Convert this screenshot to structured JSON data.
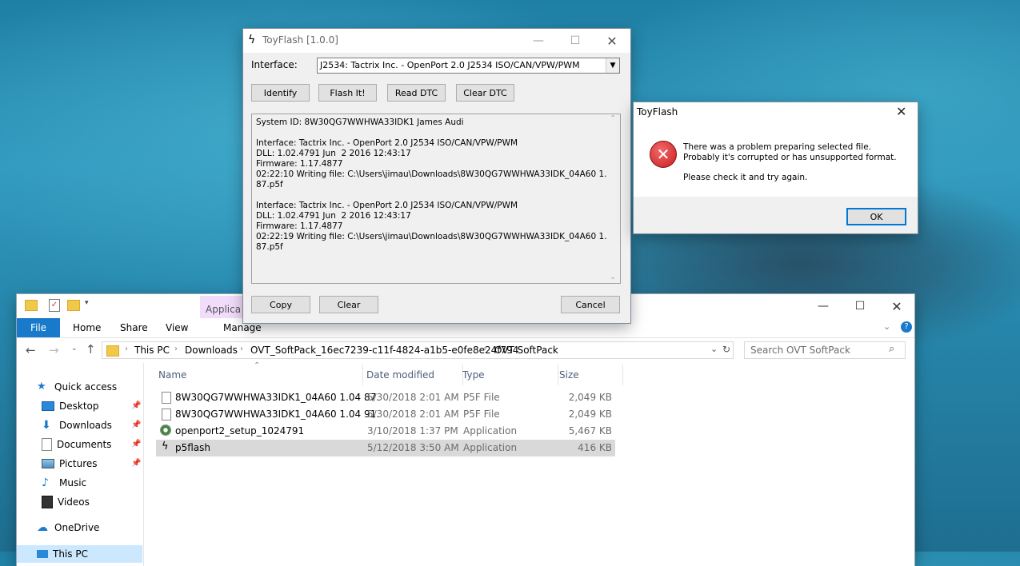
{
  "toyflash": {
    "title": "ToyFlash [1.0.0]",
    "interface_label": "Interface:",
    "interface_value": "J2534: Tactrix Inc. - OpenPort 2.0 J2534 ISO/CAN/VPW/PWM",
    "buttons": {
      "identify": "Identify",
      "flash": "Flash It!",
      "read_dtc": "Read DTC",
      "clear_dtc": "Clear DTC",
      "copy": "Copy",
      "clear": "Clear",
      "cancel": "Cancel"
    },
    "log": [
      "System ID: 8W30QG7WWHWA33IDK1 James Audi",
      "",
      "Interface: Tactrix Inc. - OpenPort 2.0 J2534 ISO/CAN/VPW/PWM",
      "DLL: 1.02.4791 Jun  2 2016 12:43:17",
      "Firmware: 1.17.4877",
      "02:22:10 Writing file: C:\\Users\\jimau\\Downloads\\8W30QG7WWHWA33IDK_04A60 1.04",
      "87.p5f",
      "",
      "Interface: Tactrix Inc. - OpenPort 2.0 J2534 ISO/CAN/VPW/PWM",
      "DLL: 1.02.4791 Jun  2 2016 12:43:17",
      "Firmware: 1.17.4877",
      "02:22:19 Writing file: C:\\Users\\jimau\\Downloads\\8W30QG7WWHWA33IDK_04A60 1.04",
      "87.p5f"
    ]
  },
  "dialog": {
    "title": "ToyFlash",
    "line1": "There was a problem preparing selected file.",
    "line2": "Probably it's corrupted or has unsupported format.",
    "line3": "Please check it and try again.",
    "ok": "OK"
  },
  "explorer": {
    "ribbon_tabs": {
      "file": "File",
      "home": "Home",
      "share": "Share",
      "view": "View",
      "app_tools": "Applica",
      "manage": "Manage"
    },
    "breadcrumb": [
      "This PC",
      "Downloads",
      "OVT_SoftPack_16ec7239-c11f-4824-a1b5-e0fe8e24f794",
      "OVT SoftPack"
    ],
    "search_placeholder": "Search OVT SoftPack",
    "columns": {
      "name": "Name",
      "date": "Date modified",
      "type": "Type",
      "size": "Size"
    },
    "nav": [
      {
        "label": "Quick access",
        "icon": "star-icon"
      },
      {
        "label": "Desktop",
        "icon": "desktop-icon"
      },
      {
        "label": "Downloads",
        "icon": "download-icon"
      },
      {
        "label": "Documents",
        "icon": "documents-icon"
      },
      {
        "label": "Pictures",
        "icon": "pictures-icon"
      },
      {
        "label": "Music",
        "icon": "music-icon"
      },
      {
        "label": "Videos",
        "icon": "videos-icon"
      },
      {
        "label": "OneDrive",
        "icon": "onedrive-icon"
      },
      {
        "label": "This PC",
        "icon": "pc-icon"
      }
    ],
    "files": [
      {
        "name": "8W30QG7WWHWA33IDK1_04A60 1.04 87.",
        "date": "5/30/2018 2:01 AM",
        "type": "P5F File",
        "size": "2,049 KB",
        "icon": "file-icon"
      },
      {
        "name": "8W30QG7WWHWA33IDK1_04A60 1.04 91.",
        "date": "5/30/2018 2:01 AM",
        "type": "P5F File",
        "size": "2,049 KB",
        "icon": "file-icon"
      },
      {
        "name": "openport2_setup_1024791",
        "date": "3/10/2018 1:37 PM",
        "type": "Application",
        "size": "5,467 KB",
        "icon": "installer-icon"
      },
      {
        "name": "p5flash",
        "date": "5/12/2018 3:50 AM",
        "type": "Application",
        "size": "416 KB",
        "icon": "lightning-icon"
      }
    ]
  },
  "colors": {
    "accent": "#0078d7",
    "selected_row": "#d9d9d9",
    "error_red": "#d32f2f"
  }
}
